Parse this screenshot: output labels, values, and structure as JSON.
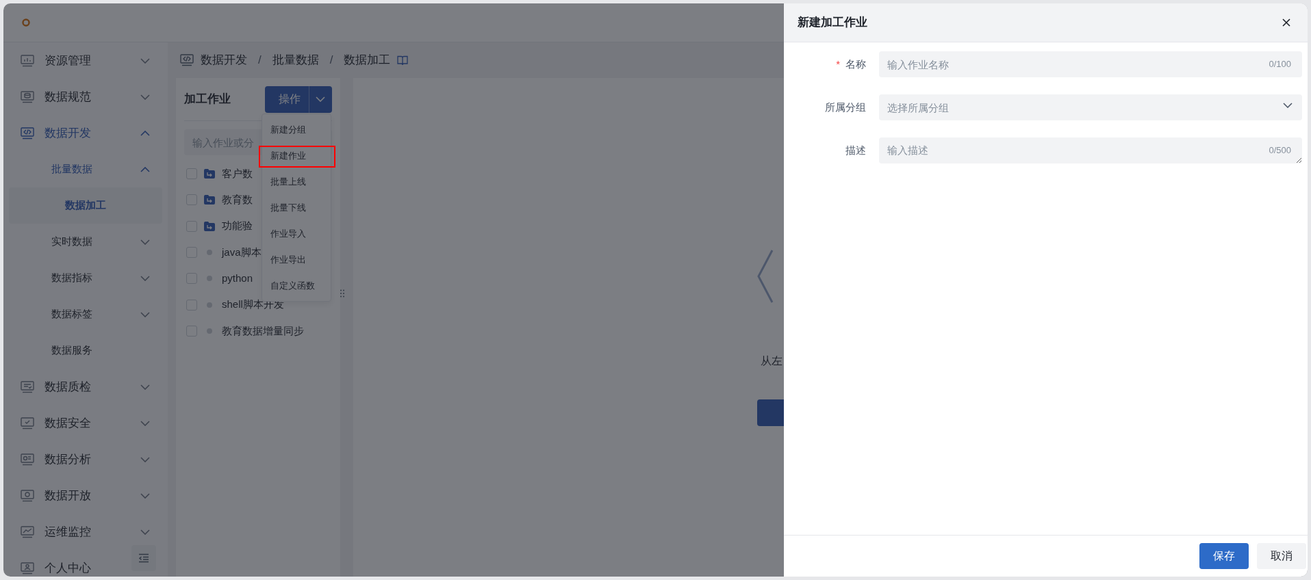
{
  "sidebar": {
    "items": [
      {
        "label": "资源管理",
        "expanded": false,
        "selected": false
      },
      {
        "label": "数据规范",
        "expanded": false,
        "selected": false
      },
      {
        "label": "数据开发",
        "expanded": true,
        "selected": true,
        "children": [
          {
            "label": "批量数据",
            "expanded": true,
            "selected": true,
            "children": [
              {
                "label": "数据加工",
                "selected": true
              }
            ]
          },
          {
            "label": "实时数据",
            "expanded": false,
            "selected": false
          },
          {
            "label": "数据指标",
            "expanded": false,
            "selected": false
          },
          {
            "label": "数据标签",
            "expanded": false,
            "selected": false
          },
          {
            "label": "数据服务",
            "selected": false
          }
        ]
      },
      {
        "label": "数据质检",
        "expanded": false,
        "selected": false
      },
      {
        "label": "数据安全",
        "expanded": false,
        "selected": false
      },
      {
        "label": "数据分析",
        "expanded": false,
        "selected": false
      },
      {
        "label": "数据开放",
        "expanded": false,
        "selected": false
      },
      {
        "label": "运维监控",
        "expanded": false,
        "selected": false
      },
      {
        "label": "个人中心",
        "selected": false
      }
    ]
  },
  "breadcrumb": {
    "items": [
      {
        "label": "数据开发",
        "separator": "/"
      },
      {
        "label": "批量数据",
        "separator": "/"
      },
      {
        "label": "数据加工"
      }
    ]
  },
  "job_panel": {
    "title": "加工作业",
    "action_button": "操作",
    "search": {
      "placeholder": "输入作业或分"
    },
    "tree": [
      {
        "kind": "folder",
        "label": "客户数",
        "checked": false
      },
      {
        "kind": "folder",
        "label": "教育数",
        "checked": false
      },
      {
        "kind": "folder",
        "label": "功能验",
        "checked": false
      },
      {
        "kind": "job",
        "label": "java脚本",
        "checked": false
      },
      {
        "kind": "job",
        "label": "python",
        "checked": false
      },
      {
        "kind": "job",
        "label": "shell脚本开发",
        "checked": false
      },
      {
        "kind": "job",
        "label": "教育数据增量同步",
        "checked": false
      }
    ]
  },
  "action_menu": {
    "items": [
      {
        "label": "新建分组",
        "highlighted": false
      },
      {
        "label": "新建作业",
        "highlighted": true
      },
      {
        "label": "批量上线",
        "highlighted": false
      },
      {
        "label": "批量下线",
        "highlighted": false
      },
      {
        "label": "作业导入",
        "highlighted": false
      },
      {
        "label": "作业导出",
        "highlighted": false
      },
      {
        "label": "自定义函数",
        "highlighted": false
      }
    ]
  },
  "empty_state": {
    "text": "从左"
  },
  "drawer": {
    "title": "新建加工作业",
    "fields": [
      {
        "kind": "text",
        "label": "名称",
        "required_mark": "*",
        "placeholder": "输入作业名称",
        "counter": "0/100"
      },
      {
        "kind": "select",
        "label": "所属分组",
        "placeholder": "选择所属分组"
      },
      {
        "kind": "textarea",
        "label": "描述",
        "placeholder": "输入描述",
        "counter": "0/500"
      }
    ],
    "buttons": [
      {
        "label": "保存",
        "kind": "primary"
      },
      {
        "label": "取消",
        "kind": "secondary"
      }
    ]
  }
}
